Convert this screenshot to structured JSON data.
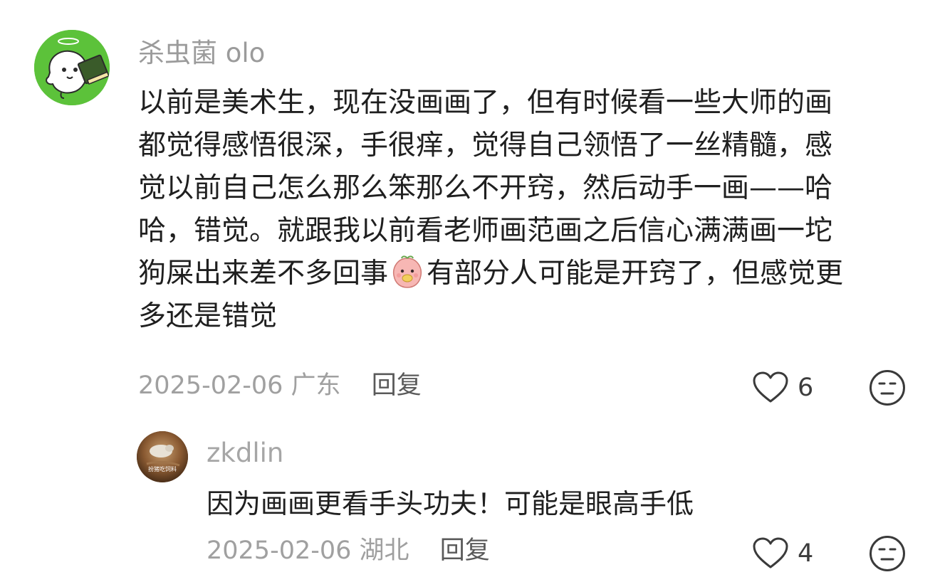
{
  "comment": {
    "username": "杀虫菌 olo",
    "avatar_icon": "cartoon-ghost-with-book-avatar",
    "lines": [
      "以前是美术生，现在没画画了，但有时候看一些大师的画",
      "都觉得感悟很深，手很痒，觉得自己领悟了一丝精髓，感",
      "觉以前自己怎么那么笨那么不开窍，然后动手一画——哈",
      "哈，错觉。就跟我以前看老师画范画之后信心满满画一坨"
    ],
    "line5_before_emoji": "狗屎出来差不多回事",
    "emoji_icon": "peach-eating-emoji",
    "line5_after_emoji": "有部分人可能是开窍了，但感觉更",
    "line6": "多还是错觉",
    "date": "2025-02-06",
    "location": "广东",
    "reply_label": "回复",
    "like_icon": "heart-outline-icon",
    "likes": "6",
    "dislike_icon": "neutral-face-icon"
  },
  "reply": {
    "username": "zkdlin",
    "avatar_icon": "brown-photo-avatar",
    "avatar_caption": "扮猪吃饲料",
    "text": "因为画画更看手头功夫！可能是眼高手低",
    "date": "2025-02-06",
    "location": "湖北",
    "reply_label": "回复",
    "like_icon": "heart-outline-icon",
    "likes": "4",
    "dislike_icon": "neutral-face-icon"
  },
  "colors": {
    "main_avatar_bg": "#5cc23a",
    "username": "#9b9b9b",
    "body_text": "#1f1f1f",
    "meta_text": "#a0a0a0",
    "reply_link": "#5a5a5a"
  }
}
